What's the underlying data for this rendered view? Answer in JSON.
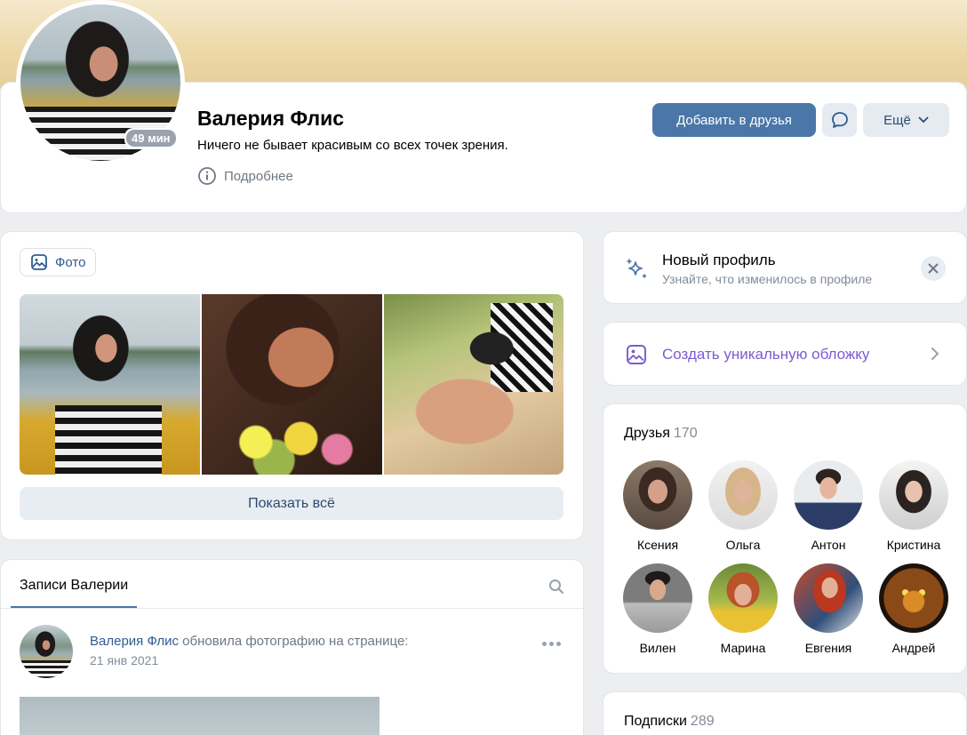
{
  "profile": {
    "name": "Валерия Флис",
    "status": "Ничего не бывает красивым со всех точек зрения.",
    "more_info": "Подробнее",
    "online_badge": "49 мин",
    "add_friend": "Добавить в друзья",
    "more_button": "Ещё"
  },
  "photos": {
    "tab_label": "Фото",
    "show_all": "Показать всё"
  },
  "new_profile": {
    "title": "Новый профиль",
    "subtitle": "Узнайте, что изменилось в профиле"
  },
  "cover": {
    "label": "Создать уникальную обложку"
  },
  "friends": {
    "title": "Друзья",
    "count": "170",
    "items": [
      {
        "name": "Ксения"
      },
      {
        "name": "Ольга"
      },
      {
        "name": "Антон"
      },
      {
        "name": "Кристина"
      },
      {
        "name": "Вилен"
      },
      {
        "name": "Марина"
      },
      {
        "name": "Евгения"
      },
      {
        "name": "Андрей"
      }
    ]
  },
  "subscriptions": {
    "title": "Подписки",
    "count": "289"
  },
  "posts": {
    "tab_label": "Записи Валерии",
    "post": {
      "author": "Валерия Флис",
      "action": "обновила фотографию на странице:",
      "date": "21 янв 2021"
    }
  },
  "colors": {
    "accent": "#4a76a8",
    "link": "#2c5d8f",
    "purple": "#7a5ccf",
    "secondary_text": "#818c99"
  }
}
